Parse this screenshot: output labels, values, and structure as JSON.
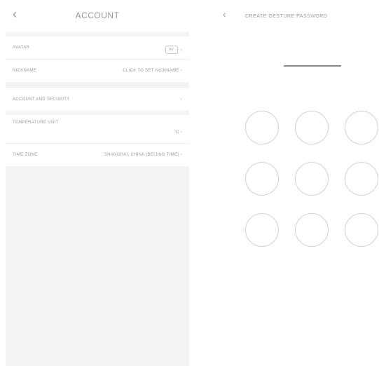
{
  "account": {
    "back_icon": "chevron-left-icon",
    "title": "ACCOUNT",
    "rows": [
      {
        "label": "AVATAR",
        "value": "",
        "chip": "AV"
      },
      {
        "label": "NICKNAME",
        "value": "CLICK TO SET NICKNAME"
      },
      {
        "label": "ACCOUNT AND SECURITY",
        "value": ""
      },
      {
        "label": "TEMPERATURE UNIT",
        "value": "°C"
      },
      {
        "label": "TIME ZONE",
        "value": "SHANGHAI, CHINA (BEIJING TIME)"
      }
    ],
    "chevron": "›"
  },
  "gesture": {
    "back_icon": "chevron-left-icon",
    "title": "CREATE GESTURE PASSWORD",
    "dots": 9
  }
}
